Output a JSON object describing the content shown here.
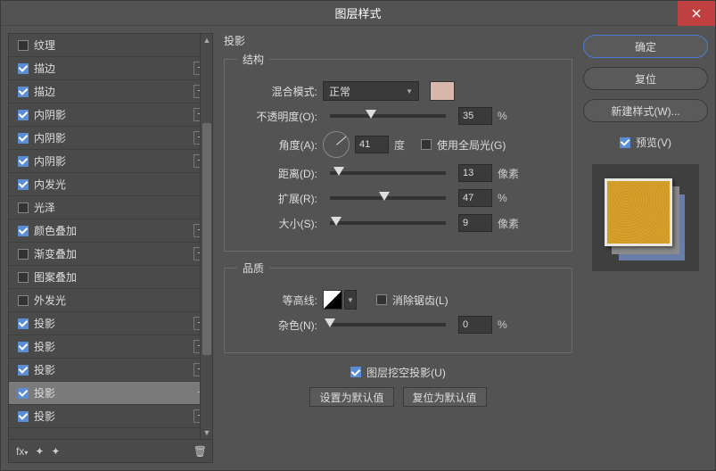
{
  "window": {
    "title": "图层样式"
  },
  "buttons": {
    "ok": "确定",
    "reset": "复位",
    "new_style": "新建样式(W)...",
    "preview": "预览(V)",
    "close": "×"
  },
  "effects": [
    {
      "label": "纹理",
      "checked": false,
      "plus": false
    },
    {
      "label": "描边",
      "checked": true,
      "plus": true
    },
    {
      "label": "描边",
      "checked": true,
      "plus": true
    },
    {
      "label": "内阴影",
      "checked": true,
      "plus": true
    },
    {
      "label": "内阴影",
      "checked": true,
      "plus": true
    },
    {
      "label": "内阴影",
      "checked": true,
      "plus": true
    },
    {
      "label": "内发光",
      "checked": true,
      "plus": false
    },
    {
      "label": "光泽",
      "checked": false,
      "plus": false
    },
    {
      "label": "颜色叠加",
      "checked": true,
      "plus": true
    },
    {
      "label": "渐变叠加",
      "checked": false,
      "plus": true
    },
    {
      "label": "图案叠加",
      "checked": false,
      "plus": false
    },
    {
      "label": "外发光",
      "checked": false,
      "plus": false
    },
    {
      "label": "投影",
      "checked": true,
      "plus": true
    },
    {
      "label": "投影",
      "checked": true,
      "plus": true
    },
    {
      "label": "投影",
      "checked": true,
      "plus": true
    },
    {
      "label": "投影",
      "checked": true,
      "plus": true,
      "selected": true
    },
    {
      "label": "投影",
      "checked": true,
      "plus": true
    }
  ],
  "footer": {
    "fx": "fx"
  },
  "panel": {
    "title": "投影",
    "sections": {
      "structure": "结构",
      "quality": "品质"
    },
    "labels": {
      "blend": "混合模式:",
      "opacity": "不透明度(O):",
      "angle": "角度(A):",
      "global": "使用全局光(G)",
      "distance": "距离(D):",
      "spread": "扩展(R):",
      "size": "大小(S):",
      "contour": "等高线:",
      "antialias": "消除锯齿(L)",
      "noise": "杂色(N):",
      "knockout": "图层挖空投影(U)",
      "deg": "度",
      "px": "像素",
      "pct": "%"
    },
    "values": {
      "blend_mode": "正常",
      "opacity": "35",
      "angle": "41",
      "global": false,
      "distance": "13",
      "spread": "47",
      "size": "9",
      "antialias": false,
      "noise": "0",
      "knockout": true,
      "color": "#d8b8ad"
    },
    "default_buttons": {
      "set": "设置为默认值",
      "reset": "复位为默认值"
    }
  }
}
